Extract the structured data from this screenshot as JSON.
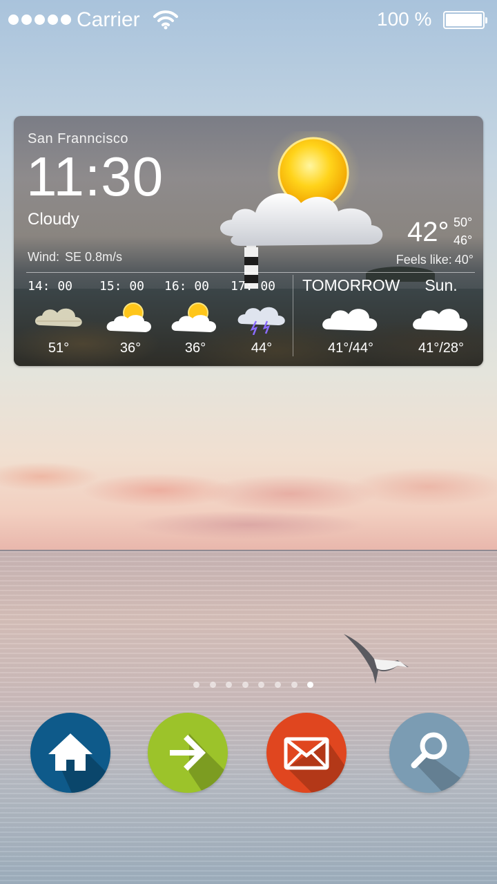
{
  "status_bar": {
    "carrier": "Carrier",
    "battery_percent": "100 %",
    "battery_level": 1.0
  },
  "weather_widget": {
    "city": "San Franncisco",
    "time": "11:30",
    "condition": "Cloudy",
    "wind_label": "Wind:",
    "wind_value": "SE 0.8m/s",
    "current_temp": "42°",
    "high": "50°",
    "low": "46°",
    "feels_like_label": "Feels like:",
    "feels_like_value": "40°",
    "hourly": [
      {
        "time": "14: 00",
        "temp": "51°",
        "icon": "cloudy-icon"
      },
      {
        "time": "15: 00",
        "temp": "36°",
        "icon": "partly-sunny-icon"
      },
      {
        "time": "16: 00",
        "temp": "36°",
        "icon": "partly-sunny-icon"
      },
      {
        "time": "17: 00",
        "temp": "44°",
        "icon": "thunderstorm-icon"
      }
    ],
    "daily": [
      {
        "label": "TOMORROW",
        "temp": "41°/44°",
        "icon": "cloud-icon"
      },
      {
        "label": "Sun.",
        "temp": "41°/28°",
        "icon": "cloud-icon"
      }
    ]
  },
  "pager": {
    "count": 8,
    "active_index": 7
  },
  "dock": [
    {
      "name": "home",
      "icon": "home-icon",
      "color": "#0e5a8a"
    },
    {
      "name": "arrow",
      "icon": "arrow-right-icon",
      "color": "#9cc32a"
    },
    {
      "name": "mail",
      "icon": "mail-icon",
      "color": "#e0461f"
    },
    {
      "name": "search",
      "icon": "search-icon",
      "color": "#7b9cb3"
    }
  ]
}
